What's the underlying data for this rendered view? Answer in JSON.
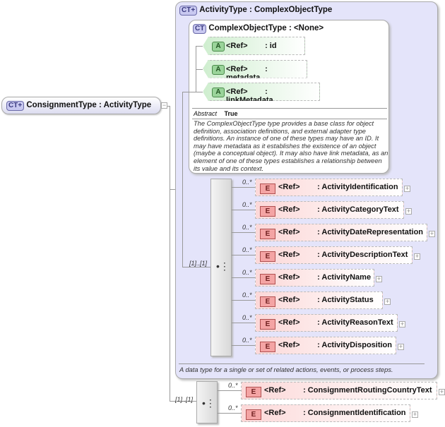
{
  "root": {
    "badge": "CT+",
    "label": "ConsignmentType : ActivityType"
  },
  "activity_type": {
    "badge": "CT+",
    "label": "ActivityType : ComplexObjectType",
    "description": "A data type for a single or set of related actions, events, or process steps.",
    "sequence_occurrence": "[1]..[1]",
    "elements": [
      {
        "ref": "<Ref>",
        "name": ": ActivityIdentification",
        "occ": "0..*"
      },
      {
        "ref": "<Ref>",
        "name": ": ActivityCategoryText",
        "occ": "0..*"
      },
      {
        "ref": "<Ref>",
        "name": ": ActivityDateRepresentation",
        "occ": "0..*"
      },
      {
        "ref": "<Ref>",
        "name": ": ActivityDescriptionText",
        "occ": "0..*"
      },
      {
        "ref": "<Ref>",
        "name": ": ActivityName",
        "occ": "0..*"
      },
      {
        "ref": "<Ref>",
        "name": ": ActivityStatus",
        "occ": "0..*"
      },
      {
        "ref": "<Ref>",
        "name": ": ActivityReasonText",
        "occ": "0..*"
      },
      {
        "ref": "<Ref>",
        "name": ": ActivityDisposition",
        "occ": "0..*"
      }
    ]
  },
  "complex_object_type": {
    "badge": "CT",
    "label": "ComplexObjectType : <None>",
    "abstract_label": "Abstract",
    "abstract_value": "True",
    "description": "The ComplexObjectType type provides a base class for object definition, association definitions, and external adapter type definitions. An instance of one of these types may have an ID. It may have metadata as it establishes the existence of an object (maybe a conceptual object). It may also have link metadata, as an element of one of these types establishes a relationship between its value and its context.",
    "attributes": [
      {
        "badge": "A",
        "ref": "<Ref>",
        "name": ": id"
      },
      {
        "badge": "A",
        "ref": "<Ref>",
        "name": ": metadata"
      },
      {
        "badge": "A",
        "ref": "<Ref>",
        "name": ": linkMetadata"
      }
    ]
  },
  "consignment": {
    "sequence_occurrence": "[1]..[1]",
    "elements": [
      {
        "ref": "<Ref>",
        "name": ": ConsignmentRoutingCountryText",
        "occ": "0..*"
      },
      {
        "ref": "<Ref>",
        "name": ": ConsignmentIdentification",
        "occ": "0..*"
      }
    ]
  }
}
